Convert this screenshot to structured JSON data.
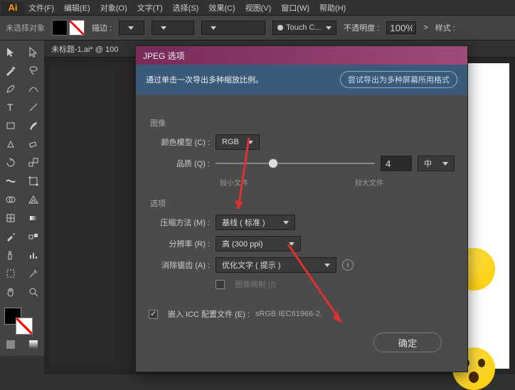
{
  "menubar": [
    "文件(F)",
    "编辑(E)",
    "对象(O)",
    "文字(T)",
    "选择(S)",
    "效果(C)",
    "视图(V)",
    "窗口(W)",
    "帮助(H)"
  ],
  "optionsbar": {
    "no_selection": "未选择对象",
    "stroke_label": "描边 :",
    "touch": "Touch C...",
    "opacity_label": "不透明度 :",
    "opacity_value": "100%",
    "style_label": "样式 :"
  },
  "doc_tab": "未标题-1.ai* @ 100",
  "dialog": {
    "title": "JPEG 选项",
    "tip": "通过单击一次导出多种缩放比例。",
    "tip_button": "尝试导出为多种屏幕所用格式",
    "sections": {
      "image": "图像",
      "options": "选项"
    },
    "color_model_label": "颜色模型 (C) :",
    "color_model_value": "RGB",
    "quality_label": "品质 (Q) :",
    "quality_value": "4",
    "quality_preset": "中",
    "quality_min": "较小文件",
    "quality_max": "较大文件",
    "compress_label": "压缩方法 (M) :",
    "compress_value": "基线 ( 标准 )",
    "resolution_label": "分辨率 (R) :",
    "resolution_value": "高 (300 ppi)",
    "antialias_label": "消除锯齿 (A) :",
    "antialias_value": "优化文字 ( 提示 )",
    "imagemap_label": "图像映射 (I)",
    "icc_label": "嵌入 ICC 配置文件 (E) :",
    "icc_value": "sRGB IEC61966-2.",
    "ok": "确定"
  },
  "tool_icons": [
    "arrow",
    "direct",
    "wand",
    "lasso",
    "pen",
    "curve",
    "type",
    "line",
    "rect",
    "brush",
    "scissors",
    "rotate",
    "scale",
    "width",
    "freeform",
    "shaper",
    "eyedrop",
    "mesh",
    "gradient",
    "blend",
    "symbol",
    "graph",
    "artboard",
    "slice",
    "hand",
    "zoom"
  ]
}
